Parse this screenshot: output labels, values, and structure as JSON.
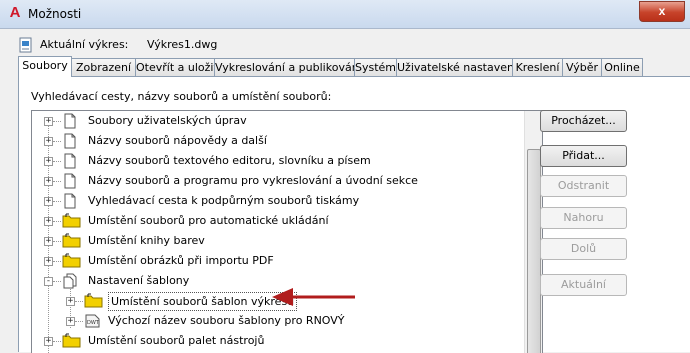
{
  "window": {
    "title": "Možnosti",
    "close_glyph": "x",
    "logo_letter": "A"
  },
  "current_drawing": {
    "label": "Aktuální výkres:",
    "value": "Výkres1.dwg"
  },
  "tabs": [
    {
      "label": "Soubory",
      "active": true
    },
    {
      "label": "Zobrazení"
    },
    {
      "label": "Otevřít a uložit"
    },
    {
      "label": "Vykreslování a publikování"
    },
    {
      "label": "Systém"
    },
    {
      "label": "Uživatelské nastavení"
    },
    {
      "label": "Kreslení"
    },
    {
      "label": "Výběr"
    },
    {
      "label": "Online"
    }
  ],
  "files_panel": {
    "search_label": "Vyhledávací cesty, názvy souborů a umístění souborů:",
    "tree": [
      {
        "label": "Soubory uživatelských úprav",
        "icon": "document-icon",
        "expander": "+"
      },
      {
        "label": "Názvy souborů nápovědy a další",
        "icon": "document-icon",
        "expander": "+"
      },
      {
        "label": "Názvy souborů textového editoru, slovníku a písem",
        "icon": "document-icon",
        "expander": "+"
      },
      {
        "label": "Názvy souborů a programu pro vykreslování a úvodní sekce",
        "icon": "document-icon",
        "expander": "+"
      },
      {
        "label": "Vyhledávací cesta k podpůrným souborů tiskámy",
        "icon": "document-icon",
        "expander": "+"
      },
      {
        "label": "Umístění souborů pro automatické ukládání",
        "icon": "folder-icon",
        "expander": "+"
      },
      {
        "label": "Umístění knihy barev",
        "icon": "folder-icon",
        "expander": "+"
      },
      {
        "label": "Umístění obrázků při importu PDF",
        "icon": "folder-icon",
        "expander": "+"
      },
      {
        "label": "Nastavení šablony",
        "icon": "template-settings-icon",
        "expander": "-"
      },
      {
        "label": "Umístění souborů šablon výkresů",
        "icon": "folder-icon",
        "expander": "+",
        "child": true,
        "selected": true
      },
      {
        "label": "Výchozí název souboru šablony pro RNOVÝ",
        "icon": "dwt-file-icon",
        "expander": "+",
        "child": true
      },
      {
        "label": "Umístění souborů palet nástrojů",
        "icon": "folder-icon",
        "expander": "+"
      }
    ],
    "buttons": [
      {
        "label": "Procházet...",
        "enabled": true
      },
      {
        "label": "Přidat...",
        "enabled": true
      },
      {
        "label": "Odstranit",
        "enabled": false
      },
      {
        "label": "Nahoru",
        "enabled": false
      },
      {
        "label": "Dolů",
        "enabled": false
      },
      {
        "label": "Aktuální",
        "enabled": false
      }
    ]
  },
  "colors": {
    "annotation_arrow": "#b11d1d",
    "folder": "#f2d000"
  }
}
